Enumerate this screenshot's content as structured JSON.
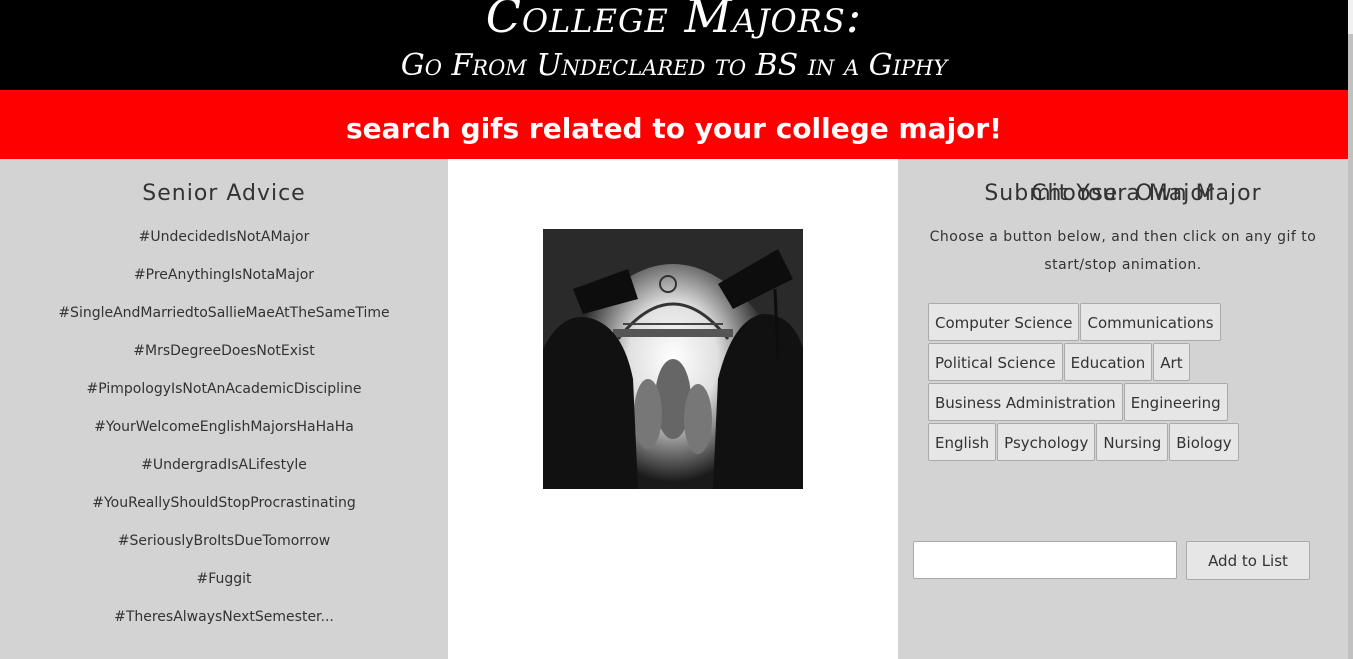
{
  "header": {
    "title": "College Majors:",
    "subtitle": "Go From Undeclared to BS in a Giphy"
  },
  "banner": {
    "text": "search gifs related to your college major!"
  },
  "advice": {
    "title": "Senior Advice",
    "items": [
      "#UndecidedIsNotAMajor",
      "#PreAnythingIsNotaMajor",
      "#SingleAndMarriedtoSallieMaeAtTheSameTime",
      "#MrsDegreeDoesNotExist",
      "#PimpologyIsNotAnAcademicDiscipline",
      "#YourWelcomeEnglishMajorsHaHaHa",
      "#UndergradIsALifestyle",
      "#YouReallyShouldStopProcrastinating",
      "#SeriouslyBroItsDueTomorrow",
      "#Fuggit",
      "#TheresAlwaysNextSemester..."
    ]
  },
  "majors": {
    "title": "Choose a Major",
    "instructions": "Choose a button below, and then click on any gif to start/stop animation.",
    "rows": [
      [
        "Computer Science",
        "Communications"
      ],
      [
        "Political Science",
        "Education",
        "Art"
      ],
      [
        "Business Administration",
        "Engineering"
      ],
      [
        "English",
        "Psychology",
        "Nursing",
        "Biology"
      ]
    ]
  },
  "submit": {
    "title": "Submit Your Own Major",
    "input_value": "",
    "button_label": "Add to List"
  },
  "colors": {
    "header": "#000000",
    "banner": "#ff0000",
    "panel": "#d3d3d3"
  },
  "image": {
    "icon": "graduates-gif"
  }
}
